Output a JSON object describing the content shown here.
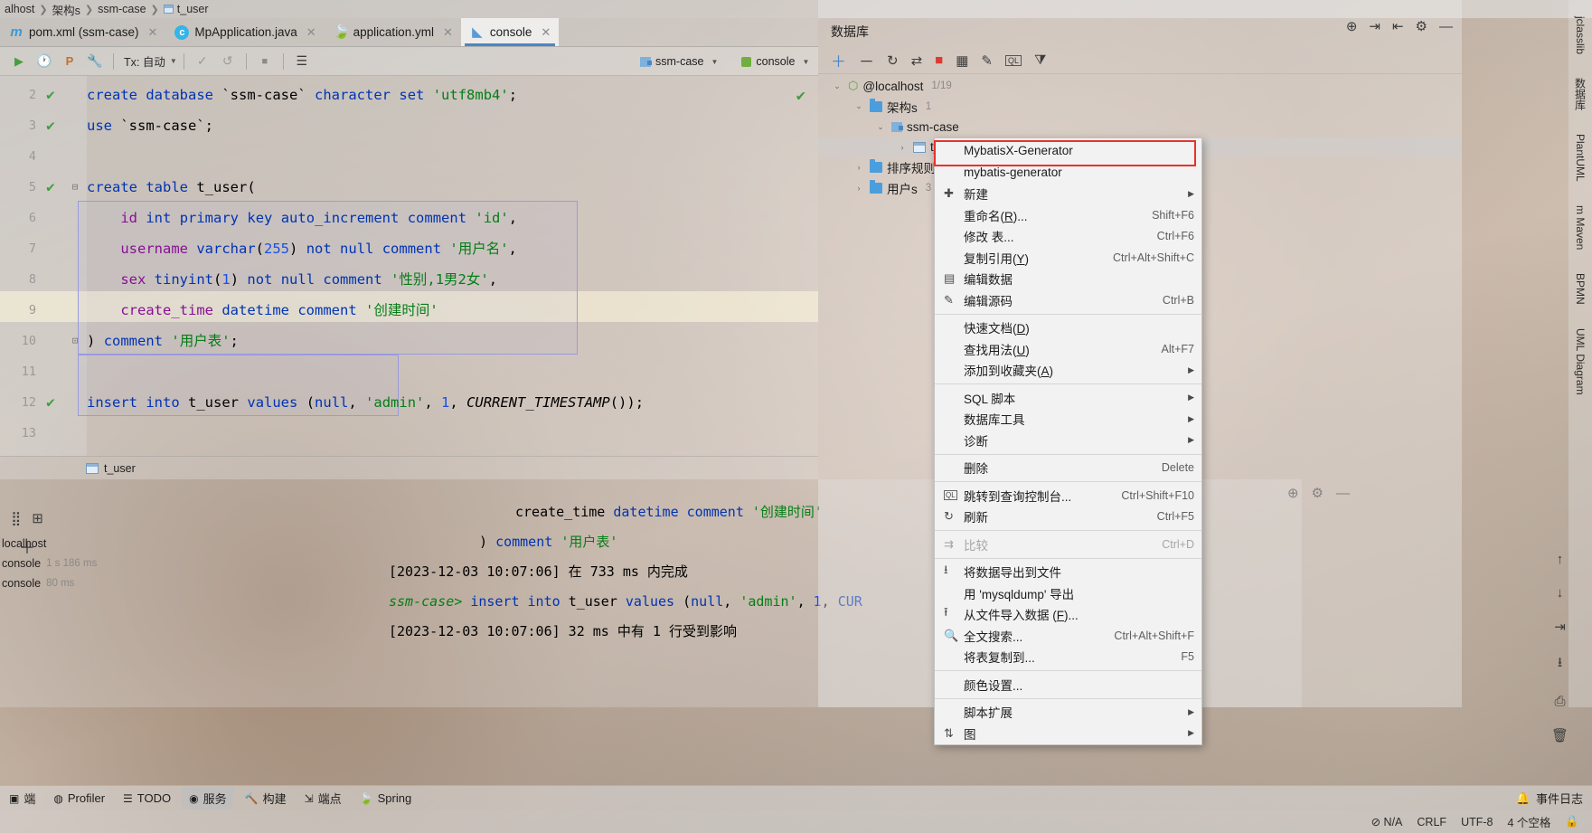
{
  "breadcrumb": {
    "items": [
      "alhost",
      "架构s",
      "ssm-case",
      "t_user"
    ]
  },
  "tabs": [
    {
      "label": "pom.xml (ssm-case)",
      "icon": "maven-m-icon",
      "close": "✕",
      "active": false
    },
    {
      "label": "MpApplication.java",
      "icon": "java-class-icon",
      "close": "✕",
      "active": false
    },
    {
      "label": "application.yml",
      "icon": "yaml-icon",
      "close": "✕",
      "active": false
    },
    {
      "label": "console",
      "icon": "console-icon",
      "close": "✕",
      "active": true
    }
  ],
  "editor_toolbar": {
    "run_label": "▶",
    "history_label": "🕐",
    "profile_label": "P",
    "wrench_label": "🔧",
    "tx_label": "Tx: 自动",
    "commit_label": "✓",
    "rollback_label": "↺",
    "stop_label": "■",
    "rows_label": "☰",
    "schema": "ssm-case",
    "session": "console"
  },
  "code": {
    "lines": [
      {
        "num": "2",
        "mark": "✔",
        "fold": "",
        "tokens": [
          {
            "t": "create",
            "c": "k"
          },
          {
            "t": " ",
            "c": "pl"
          },
          {
            "t": "database",
            "c": "k"
          },
          {
            "t": " ",
            "c": "pl"
          },
          {
            "t": "`ssm-case`",
            "c": "id"
          },
          {
            "t": " ",
            "c": "pl"
          },
          {
            "t": "character",
            "c": "k"
          },
          {
            "t": " ",
            "c": "pl"
          },
          {
            "t": "set",
            "c": "k"
          },
          {
            "t": " ",
            "c": "pl"
          },
          {
            "t": "'utf8mb4'",
            "c": "st"
          },
          {
            "t": ";",
            "c": "pl"
          }
        ]
      },
      {
        "num": "3",
        "mark": "✔",
        "fold": "",
        "tokens": [
          {
            "t": "use",
            "c": "k"
          },
          {
            "t": " ",
            "c": "pl"
          },
          {
            "t": "`ssm-case`",
            "c": "id"
          },
          {
            "t": ";",
            "c": "pl"
          }
        ]
      },
      {
        "num": "4",
        "mark": "",
        "fold": "",
        "tokens": []
      },
      {
        "num": "5",
        "mark": "✔",
        "fold": "⊟",
        "tokens": [
          {
            "t": "create",
            "c": "k"
          },
          {
            "t": " ",
            "c": "pl"
          },
          {
            "t": "table",
            "c": "k"
          },
          {
            "t": " ",
            "c": "pl"
          },
          {
            "t": "t_user",
            "c": "id"
          },
          {
            "t": "(",
            "c": "pl"
          }
        ]
      },
      {
        "num": "6",
        "mark": "",
        "fold": "",
        "tokens": [
          {
            "t": "    ",
            "c": "pl"
          },
          {
            "t": "id",
            "c": "col"
          },
          {
            "t": " ",
            "c": "pl"
          },
          {
            "t": "int",
            "c": "k"
          },
          {
            "t": " ",
            "c": "pl"
          },
          {
            "t": "primary",
            "c": "k"
          },
          {
            "t": " ",
            "c": "pl"
          },
          {
            "t": "key",
            "c": "k"
          },
          {
            "t": " ",
            "c": "pl"
          },
          {
            "t": "auto_increment",
            "c": "k"
          },
          {
            "t": " ",
            "c": "pl"
          },
          {
            "t": "comment",
            "c": "k"
          },
          {
            "t": " ",
            "c": "pl"
          },
          {
            "t": "'id'",
            "c": "st"
          },
          {
            "t": ",",
            "c": "pl"
          }
        ]
      },
      {
        "num": "7",
        "mark": "",
        "fold": "",
        "tokens": [
          {
            "t": "    ",
            "c": "pl"
          },
          {
            "t": "username",
            "c": "col"
          },
          {
            "t": " ",
            "c": "pl"
          },
          {
            "t": "varchar",
            "c": "k"
          },
          {
            "t": "(",
            "c": "pl"
          },
          {
            "t": "255",
            "c": "nm"
          },
          {
            "t": ")",
            "c": "pl"
          },
          {
            "t": " ",
            "c": "pl"
          },
          {
            "t": "not",
            "c": "k"
          },
          {
            "t": " ",
            "c": "pl"
          },
          {
            "t": "null",
            "c": "k"
          },
          {
            "t": " ",
            "c": "pl"
          },
          {
            "t": "comment",
            "c": "k"
          },
          {
            "t": " ",
            "c": "pl"
          },
          {
            "t": "'用户名'",
            "c": "st"
          },
          {
            "t": ",",
            "c": "pl"
          }
        ]
      },
      {
        "num": "8",
        "mark": "",
        "fold": "",
        "tokens": [
          {
            "t": "    ",
            "c": "pl"
          },
          {
            "t": "sex",
            "c": "col"
          },
          {
            "t": " ",
            "c": "pl"
          },
          {
            "t": "tinyint",
            "c": "k"
          },
          {
            "t": "(",
            "c": "pl"
          },
          {
            "t": "1",
            "c": "nm"
          },
          {
            "t": ")",
            "c": "pl"
          },
          {
            "t": " ",
            "c": "pl"
          },
          {
            "t": "not",
            "c": "k"
          },
          {
            "t": " ",
            "c": "pl"
          },
          {
            "t": "null",
            "c": "k"
          },
          {
            "t": " ",
            "c": "pl"
          },
          {
            "t": "comment",
            "c": "k"
          },
          {
            "t": " ",
            "c": "pl"
          },
          {
            "t": "'性别,1男2女'",
            "c": "st"
          },
          {
            "t": ",",
            "c": "pl"
          }
        ]
      },
      {
        "num": "9",
        "mark": "",
        "fold": "",
        "tokens": [
          {
            "t": "    ",
            "c": "pl"
          },
          {
            "t": "create_time",
            "c": "col"
          },
          {
            "t": " ",
            "c": "pl"
          },
          {
            "t": "datetime",
            "c": "k"
          },
          {
            "t": " ",
            "c": "pl"
          },
          {
            "t": "comment",
            "c": "k"
          },
          {
            "t": " ",
            "c": "pl"
          },
          {
            "t": "'创建时间'",
            "c": "st"
          }
        ]
      },
      {
        "num": "10",
        "mark": "",
        "fold": "⊡",
        "tokens": [
          {
            "t": ")",
            "c": "pl"
          },
          {
            "t": " ",
            "c": "pl"
          },
          {
            "t": "comment",
            "c": "k"
          },
          {
            "t": " ",
            "c": "pl"
          },
          {
            "t": "'用户表'",
            "c": "st"
          },
          {
            "t": ";",
            "c": "pl"
          }
        ]
      },
      {
        "num": "11",
        "mark": "",
        "fold": "",
        "tokens": []
      },
      {
        "num": "12",
        "mark": "✔",
        "fold": "",
        "tokens": [
          {
            "t": "insert",
            "c": "k"
          },
          {
            "t": " ",
            "c": "pl"
          },
          {
            "t": "into",
            "c": "k"
          },
          {
            "t": " ",
            "c": "pl"
          },
          {
            "t": "t_user",
            "c": "id"
          },
          {
            "t": " ",
            "c": "pl"
          },
          {
            "t": "values",
            "c": "k"
          },
          {
            "t": " ",
            "c": "pl"
          },
          {
            "t": "(",
            "c": "pl"
          },
          {
            "t": "null",
            "c": "k"
          },
          {
            "t": ", ",
            "c": "pl"
          },
          {
            "t": "'admin'",
            "c": "st"
          },
          {
            "t": ", ",
            "c": "pl"
          },
          {
            "t": "1",
            "c": "nm"
          },
          {
            "t": ", ",
            "c": "pl"
          },
          {
            "t": "CURRENT_TIMESTAMP",
            "c": "fn"
          },
          {
            "t": "());",
            "c": "pl"
          }
        ]
      },
      {
        "num": "13",
        "mark": "",
        "fold": "",
        "tokens": []
      }
    ],
    "editor_check": "✔"
  },
  "result_strip": {
    "label": "t_user"
  },
  "bottom_panel": {
    "tree": [
      {
        "label": "localhost",
        "time": ""
      },
      {
        "label": "console",
        "time": "1 s 186 ms"
      },
      {
        "label": "console",
        "time": "80 ms"
      }
    ],
    "output": [
      "create_time datetime comment '创建时间'",
      ") comment '用户表'",
      "[2023-12-03 10:07:06] 在 733 ms 内完成",
      "ssm-case> insert into t_user values (null, 'admin', 1, CUR",
      "[2023-12-03 10:07:06] 32 ms 中有 1 行受到影响"
    ],
    "toolbar": [
      "rerun-icon",
      "layout-icon",
      "add-icon"
    ]
  },
  "db_panel": {
    "title": "数据库",
    "title_icons": [
      "globe-icon",
      "collapse-in-icon",
      "expand-out-icon",
      "gear-icon",
      "minimize-icon"
    ],
    "toolbar_icons": [
      "add-icon",
      "minus-icon",
      "refresh-icon",
      "sync-script-icon",
      "stop-icon",
      "table-icon",
      "edit-icon",
      "query-console-icon",
      "filter-icon"
    ],
    "tree": [
      {
        "indent": 0,
        "arrow": "⌄",
        "icon": "host-icon",
        "label": "@localhost",
        "count": "1/19",
        "selected": false
      },
      {
        "indent": 1,
        "arrow": "⌄",
        "icon": "folder-icon",
        "label": "架构s",
        "count": "1",
        "selected": false
      },
      {
        "indent": 2,
        "arrow": "⌄",
        "icon": "schema-icon",
        "label": "ssm-case",
        "count": "",
        "selected": false
      },
      {
        "indent": 3,
        "arrow": "›",
        "icon": "table-icon",
        "label": "t_u",
        "count": "",
        "selected": true
      },
      {
        "indent": 1,
        "arrow": "›",
        "icon": "folder-icon",
        "label": "排序规则s",
        "count": "",
        "selected": false
      },
      {
        "indent": 1,
        "arrow": "›",
        "icon": "folder-icon",
        "label": "用户s",
        "count": "3",
        "selected": false
      }
    ]
  },
  "context_menu": {
    "highlighted_item": "MybatisX-Generator",
    "items": [
      {
        "icon": "",
        "label": "MybatisX-Generator",
        "shortcut": "",
        "arrow": false,
        "disabled": false,
        "sep_after": false,
        "first": true
      },
      {
        "icon": "",
        "label": "mybatis-generator",
        "shortcut": "",
        "arrow": false,
        "disabled": false,
        "sep_after": false
      },
      {
        "icon": "✚",
        "label": "新建",
        "shortcut": "",
        "arrow": true,
        "disabled": false,
        "sep_after": false
      },
      {
        "icon": "",
        "label": "重命名(R)...",
        "shortcut": "Shift+F6",
        "arrow": false,
        "disabled": false,
        "sep_after": false
      },
      {
        "icon": "",
        "label": "修改 表...",
        "shortcut": "Ctrl+F6",
        "arrow": false,
        "disabled": false,
        "sep_after": false
      },
      {
        "icon": "",
        "label": "复制引用(Y)",
        "shortcut": "Ctrl+Alt+Shift+C",
        "arrow": false,
        "disabled": false,
        "sep_after": false
      },
      {
        "icon": "▤",
        "label": "编辑数据",
        "shortcut": "",
        "arrow": false,
        "disabled": false,
        "sep_after": false
      },
      {
        "icon": "✎",
        "label": "编辑源码",
        "shortcut": "Ctrl+B",
        "arrow": false,
        "disabled": false,
        "sep_after": true
      },
      {
        "icon": "",
        "label": "快速文档(D)",
        "shortcut": "",
        "arrow": false,
        "disabled": false,
        "sep_after": false
      },
      {
        "icon": "",
        "label": "查找用法(U)",
        "shortcut": "Alt+F7",
        "arrow": false,
        "disabled": false,
        "sep_after": false
      },
      {
        "icon": "",
        "label": "添加到收藏夹(A)",
        "shortcut": "",
        "arrow": true,
        "disabled": false,
        "sep_after": true
      },
      {
        "icon": "",
        "label": "SQL 脚本",
        "shortcut": "",
        "arrow": true,
        "disabled": false,
        "sep_after": false
      },
      {
        "icon": "",
        "label": "数据库工具",
        "shortcut": "",
        "arrow": true,
        "disabled": false,
        "sep_after": false
      },
      {
        "icon": "",
        "label": "诊断",
        "shortcut": "",
        "arrow": true,
        "disabled": false,
        "sep_after": true
      },
      {
        "icon": "",
        "label": "删除",
        "shortcut": "Delete",
        "arrow": false,
        "disabled": false,
        "sep_after": true
      },
      {
        "icon": "QL",
        "label": "跳转到查询控制台...",
        "shortcut": "Ctrl+Shift+F10",
        "arrow": false,
        "disabled": false,
        "sep_after": false
      },
      {
        "icon": "↻",
        "label": "刷新",
        "shortcut": "Ctrl+F5",
        "arrow": false,
        "disabled": false,
        "sep_after": true
      },
      {
        "icon": "⇉",
        "label": "比较",
        "shortcut": "Ctrl+D",
        "arrow": false,
        "disabled": true,
        "sep_after": true
      },
      {
        "icon": "⭳",
        "label": "将数据导出到文件",
        "shortcut": "",
        "arrow": false,
        "disabled": false,
        "sep_after": false
      },
      {
        "icon": "",
        "label": "用 'mysqldump' 导出",
        "shortcut": "",
        "arrow": false,
        "disabled": false,
        "sep_after": false
      },
      {
        "icon": "⭱",
        "label": "从文件导入数据 (F)...",
        "shortcut": "",
        "arrow": false,
        "disabled": false,
        "sep_after": false
      },
      {
        "icon": "🔍",
        "label": "全文搜索...",
        "shortcut": "Ctrl+Alt+Shift+F",
        "arrow": false,
        "disabled": false,
        "sep_after": false
      },
      {
        "icon": "",
        "label": "将表复制到...",
        "shortcut": "F5",
        "arrow": false,
        "disabled": false,
        "sep_after": true
      },
      {
        "icon": "",
        "label": "颜色设置...",
        "shortcut": "",
        "arrow": false,
        "disabled": false,
        "sep_after": true
      },
      {
        "icon": "",
        "label": "脚本扩展",
        "shortcut": "",
        "arrow": true,
        "disabled": false,
        "sep_after": false
      },
      {
        "icon": "⇅",
        "label": "图",
        "shortcut": "",
        "arrow": true,
        "disabled": false,
        "sep_after": false
      }
    ]
  },
  "right_strip": {
    "labels": [
      "jclasslib",
      "数据库",
      "PlantUML",
      "m Maven",
      "BPMN",
      "UML Diagram"
    ]
  },
  "bottom_bar": {
    "items": [
      {
        "label": "端",
        "icon": "terminal-icon",
        "active": false
      },
      {
        "label": "Profiler",
        "icon": "profiler-icon",
        "active": false
      },
      {
        "label": "TODO",
        "icon": "todo-icon",
        "active": false
      },
      {
        "label": "服务",
        "icon": "services-icon",
        "active": true
      },
      {
        "label": "构建",
        "icon": "build-icon",
        "active": false
      },
      {
        "label": "端点",
        "icon": "endpoints-icon",
        "active": false
      },
      {
        "label": "Spring",
        "icon": "spring-icon",
        "active": false
      }
    ],
    "right_label": "事件日志",
    "right_icon": "bell-icon"
  },
  "status_bar": {
    "items": [
      "⊘ N/A",
      "CRLF",
      "UTF-8",
      "4 个空格"
    ],
    "lock_icon": "lock-icon"
  },
  "colors": {
    "accent_blue": "#4a86c8",
    "highlight_red": "#e8332a",
    "keyword": "#0033b3",
    "string": "#067d17",
    "number": "#1750eb",
    "column": "#871094",
    "check_green": "#3f9e3f"
  }
}
